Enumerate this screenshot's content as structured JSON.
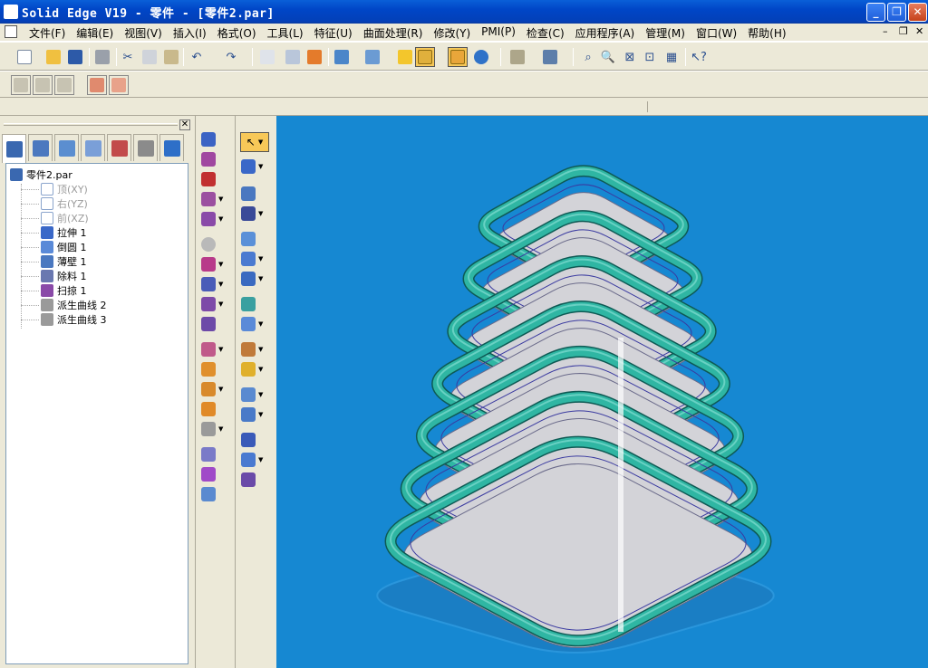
{
  "window": {
    "title": "Solid Edge V19 - 零件 - [零件2.par]"
  },
  "menu": [
    "文件(F)",
    "编辑(E)",
    "视图(V)",
    "插入(I)",
    "格式(O)",
    "工具(L)",
    "特征(U)",
    "曲面处理(R)",
    "修改(Y)",
    "PMI(P)",
    "检查(C)",
    "应用程序(A)",
    "管理(M)",
    "窗口(W)",
    "帮助(H)"
  ],
  "tree": {
    "root": "零件2.par",
    "items": [
      {
        "label": "顶(XY)",
        "dim": true,
        "icon": "plane-icon"
      },
      {
        "label": "右(YZ)",
        "dim": true,
        "icon": "plane-icon"
      },
      {
        "label": "前(XZ)",
        "dim": true,
        "icon": "plane-icon"
      },
      {
        "label": "拉伸 1",
        "dim": false,
        "icon": "extrude-icon"
      },
      {
        "label": "倒圆 1",
        "dim": false,
        "icon": "round-icon"
      },
      {
        "label": "薄壁 1",
        "dim": false,
        "icon": "thinwall-icon"
      },
      {
        "label": "除料 1",
        "dim": false,
        "icon": "cutout-icon"
      },
      {
        "label": "扫掠 1",
        "dim": false,
        "icon": "sweep-icon"
      },
      {
        "label": "派生曲线 2",
        "dim": false,
        "icon": "derived-curve-icon"
      },
      {
        "label": "派生曲线 3",
        "dim": false,
        "icon": "derived-curve-icon"
      }
    ]
  },
  "colors": {
    "viewport_bg": "#1688d2",
    "tube": "#2fb6a3",
    "body": "#d3d3d8",
    "titlebar": "#0046c7"
  }
}
